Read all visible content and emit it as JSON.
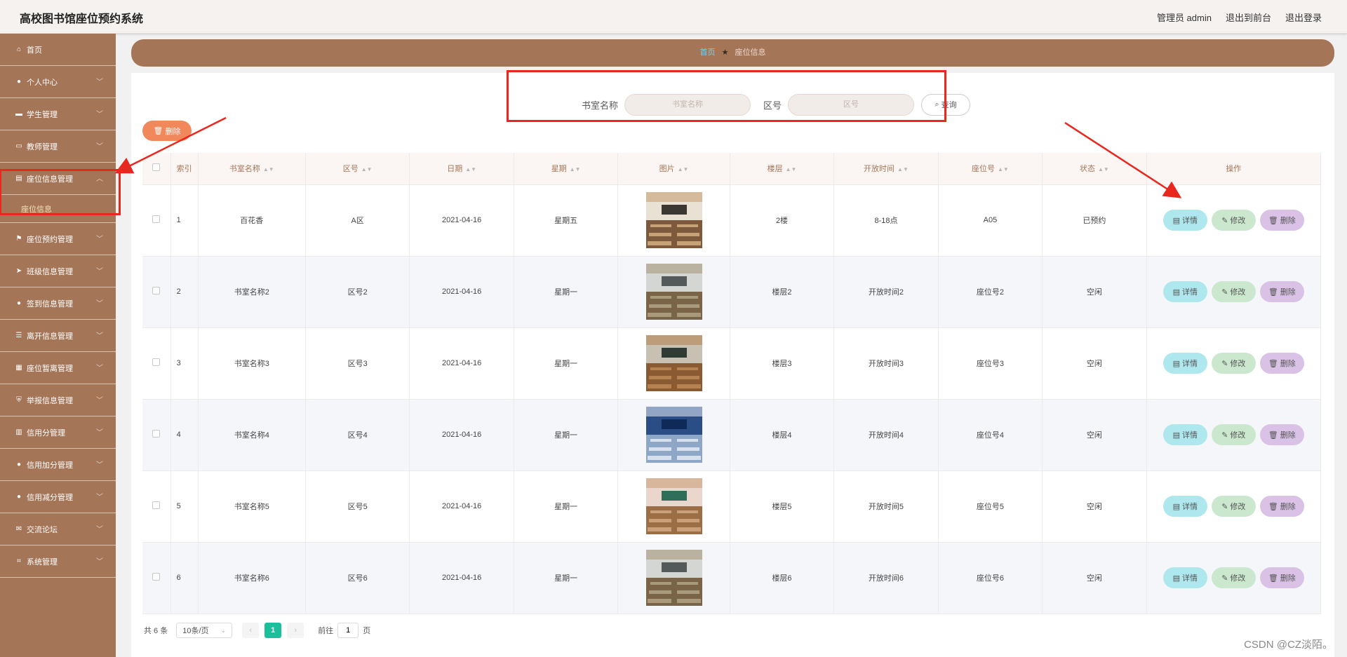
{
  "app": {
    "title": "高校图书馆座位预约系统"
  },
  "header": {
    "user": "管理员 admin",
    "front": "退出到前台",
    "logout": "退出登录"
  },
  "sidebar": {
    "items": [
      {
        "label": "首页",
        "icon": "home-icon",
        "glyph": "⌂",
        "chev": false
      },
      {
        "label": "个人中心",
        "icon": "user-icon",
        "glyph": "●",
        "chev": true
      },
      {
        "label": "学生管理",
        "icon": "id-card-icon",
        "glyph": "▬",
        "chev": true
      },
      {
        "label": "教师管理",
        "icon": "monitor-icon",
        "glyph": "▭",
        "chev": true
      },
      {
        "label": "座位信息管理",
        "icon": "document-icon",
        "glyph": "▤",
        "chev": true,
        "open": true,
        "sub": "座位信息"
      },
      {
        "label": "座位预约管理",
        "icon": "flag-icon",
        "glyph": "⚑",
        "chev": true
      },
      {
        "label": "班级信息管理",
        "icon": "send-icon",
        "glyph": "➤",
        "chev": true
      },
      {
        "label": "签到信息管理",
        "icon": "user-check-icon",
        "glyph": "●",
        "chev": true
      },
      {
        "label": "离开信息管理",
        "icon": "list-icon",
        "glyph": "☰",
        "chev": true
      },
      {
        "label": "座位暂离管理",
        "icon": "grid-icon",
        "glyph": "▦",
        "chev": true
      },
      {
        "label": "举报信息管理",
        "icon": "shield-icon",
        "glyph": "⛨",
        "chev": true
      },
      {
        "label": "信用分管理",
        "icon": "chart-icon",
        "glyph": "▥",
        "chev": true
      },
      {
        "label": "信用加分管理",
        "icon": "pin-icon",
        "glyph": "●",
        "chev": true
      },
      {
        "label": "信用减分管理",
        "icon": "user-minus-icon",
        "glyph": "●",
        "chev": true
      },
      {
        "label": "交流论坛",
        "icon": "chat-icon",
        "glyph": "✉",
        "chev": true
      },
      {
        "label": "系统管理",
        "icon": "crop-icon",
        "glyph": "⌗",
        "chev": true
      }
    ]
  },
  "breadcrumb": {
    "home": "首页",
    "current": "座位信息"
  },
  "search": {
    "name_label": "书室名称",
    "name_placeholder": "书室名称",
    "zone_label": "区号",
    "zone_placeholder": "区号",
    "query_label": "查询"
  },
  "toolbar": {
    "delete_label": "删除"
  },
  "table": {
    "columns": [
      "索引",
      "书室名称",
      "区号",
      "日期",
      "星期",
      "图片",
      "楼层",
      "开放时间",
      "座位号",
      "状态",
      "操作"
    ],
    "rows": [
      {
        "index": "1",
        "name": "百花香",
        "zone": "A区",
        "date": "2021-04-16",
        "week": "星期五",
        "floor": "2楼",
        "hours": "8-18点",
        "seat": "A05",
        "status": "已预约",
        "img": "classroom-photo-warm"
      },
      {
        "index": "2",
        "name": "书室名称2",
        "zone": "区号2",
        "date": "2021-04-16",
        "week": "星期一",
        "floor": "楼层2",
        "hours": "开放时间2",
        "seat": "座位号2",
        "status": "空闲",
        "img": "classroom-photo-grey"
      },
      {
        "index": "3",
        "name": "书室名称3",
        "zone": "区号3",
        "date": "2021-04-16",
        "week": "星期一",
        "floor": "楼层3",
        "hours": "开放时间3",
        "seat": "座位号3",
        "status": "空闲",
        "img": "classroom-photo-wood"
      },
      {
        "index": "4",
        "name": "书室名称4",
        "zone": "区号4",
        "date": "2021-04-16",
        "week": "星期一",
        "floor": "楼层4",
        "hours": "开放时间4",
        "seat": "座位号4",
        "status": "空闲",
        "img": "classroom-photo-blue"
      },
      {
        "index": "5",
        "name": "书室名称5",
        "zone": "区号5",
        "date": "2021-04-16",
        "week": "星期一",
        "floor": "楼层5",
        "hours": "开放时间5",
        "seat": "座位号5",
        "status": "空闲",
        "img": "classroom-photo-pink"
      },
      {
        "index": "6",
        "name": "书室名称6",
        "zone": "区号6",
        "date": "2021-04-16",
        "week": "星期一",
        "floor": "楼层6",
        "hours": "开放时间6",
        "seat": "座位号6",
        "status": "空闲",
        "img": "classroom-photo-grey"
      }
    ],
    "actions": {
      "detail": "详情",
      "edit": "修改",
      "delete": "删除"
    }
  },
  "pagination": {
    "total": "共 6 条",
    "size": "10条/页",
    "current": "1",
    "goto": "前往",
    "page_value": "1",
    "page_unit": "页",
    "prev": "‹",
    "next": "›"
  },
  "watermark": "CSDN @CZ淡陌。",
  "colors": {
    "sidebar": "#a57558",
    "accent": "#1bbf9c",
    "annotation": "#e8271f"
  }
}
